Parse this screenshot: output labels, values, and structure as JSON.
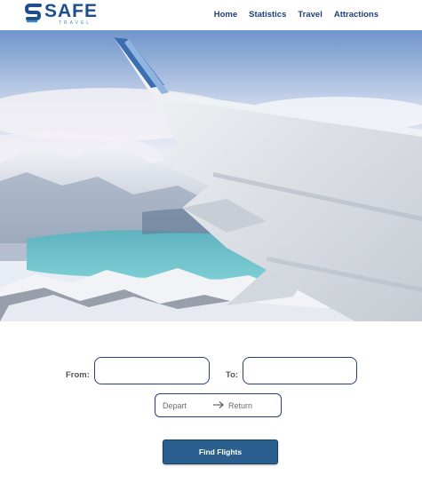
{
  "brand": {
    "name": "SAFE",
    "tagline": "TRAVEL",
    "primary_color": "#1c4f8c",
    "accent_color": "#3b8ec2"
  },
  "nav": {
    "items": [
      "Home",
      "Statistics",
      "Travel",
      "Attractions"
    ],
    "color": "#1f3f80"
  },
  "hero": {
    "image": "airplane-wing-over-snowy-mountains-and-lake"
  },
  "search": {
    "from_label": "From:",
    "from_value": "",
    "to_label": "To:",
    "to_value": "",
    "depart_placeholder": "Depart",
    "return_placeholder": "Return",
    "submit_label": "Find Flights",
    "button_color": "#2b5f8f"
  }
}
